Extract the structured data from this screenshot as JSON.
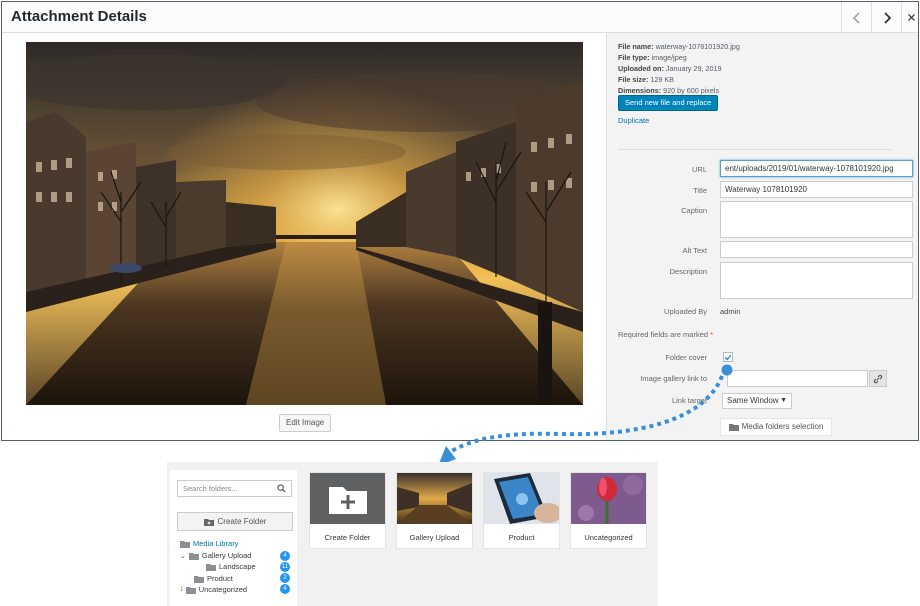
{
  "modal": {
    "title": "Attachment Details",
    "edit_image_label": "Edit Image"
  },
  "details": {
    "file_name_label": "File name:",
    "file_name": "waterway-1078101920.jpg",
    "file_type_label": "File type:",
    "file_type": "image/jpeg",
    "uploaded_on_label": "Uploaded on:",
    "uploaded_on": "January 29, 2019",
    "file_size_label": "File size:",
    "file_size": "129 KB",
    "dimensions_label": "Dimensions:",
    "dimensions": "920 by 600 pixels",
    "replace_button": "Send new file and replace",
    "duplicate_link": "Duplicate"
  },
  "fields": {
    "url_label": "URL",
    "url_value": "ent/uploads/2019/01/waterway-1078101920.jpg",
    "title_label": "Title",
    "title_value": "Waterway 1078101920",
    "caption_label": "Caption",
    "alt_text_label": "Alt Text",
    "description_label": "Description",
    "uploaded_by_label": "Uploaded By",
    "uploaded_by_value": "admin",
    "required_note": "Required fields are marked",
    "required_star": "*",
    "folder_cover_label": "Folder cover",
    "gallery_link_label": "Image gallery link to",
    "link_target_label": "Link target",
    "link_target_value": "Same Window",
    "media_folders_button": "Media folders selection"
  },
  "folders": {
    "search_placeholder": "Search folders...",
    "create_folder_button": "Create Folder",
    "tree": [
      {
        "label": "Media Library",
        "count": ""
      },
      {
        "label": "Gallery Upload",
        "count": "4"
      },
      {
        "label": "Landscape",
        "count": "11"
      },
      {
        "label": "Product",
        "count": "2"
      },
      {
        "label": "Uncategorized",
        "count": "4"
      }
    ],
    "tiles": [
      {
        "label": "Create Folder"
      },
      {
        "label": "Gallery Upload"
      },
      {
        "label": "Product"
      },
      {
        "label": "Uncategorized"
      }
    ]
  },
  "colors": {
    "primary_button": "#0085ba",
    "link": "#0073aa",
    "badge": "#2196f3",
    "arrow": "#3a8fd8"
  }
}
